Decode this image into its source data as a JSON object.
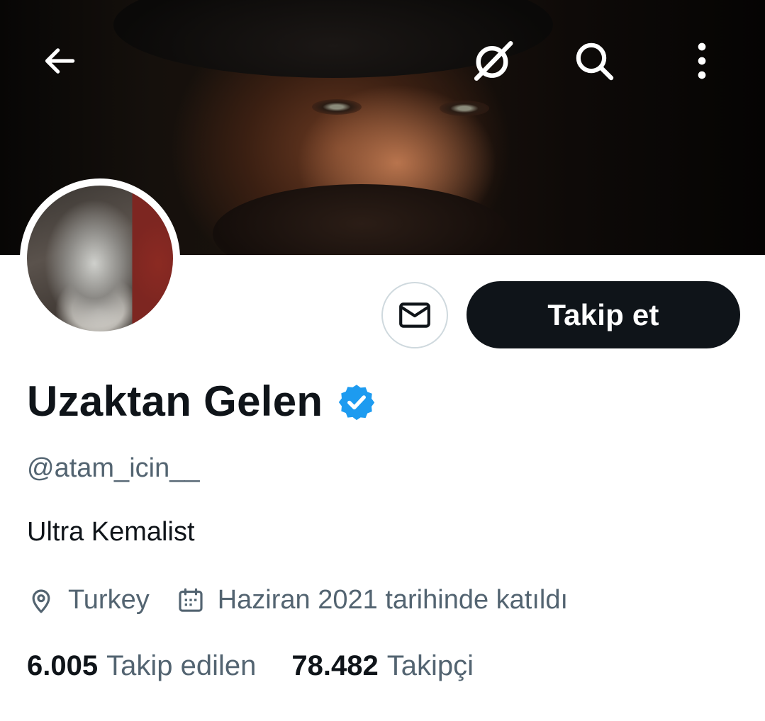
{
  "header": {
    "back_icon": "arrow-left-icon",
    "grok_icon": "grok-icon",
    "search_icon": "search-icon",
    "more_icon": "more-vertical-icon"
  },
  "profile": {
    "display_name": "Uzaktan Gelen",
    "verified": true,
    "verified_color": "#1d9bf0",
    "handle": "@atam_icin__",
    "bio": "Ultra Kemalist",
    "location": "Turkey",
    "joined": "Haziran 2021 tarihinde katıldı"
  },
  "actions": {
    "message_icon": "envelope-icon",
    "follow_label": "Takip et"
  },
  "stats": {
    "following_count": "6.005",
    "following_label": "Takip edilen",
    "followers_count": "78.482",
    "followers_label": "Takipçi"
  },
  "colors": {
    "primary_text": "#0f1419",
    "secondary_text": "#536471",
    "follow_button": "#0f1419",
    "border": "#cfd9de"
  }
}
